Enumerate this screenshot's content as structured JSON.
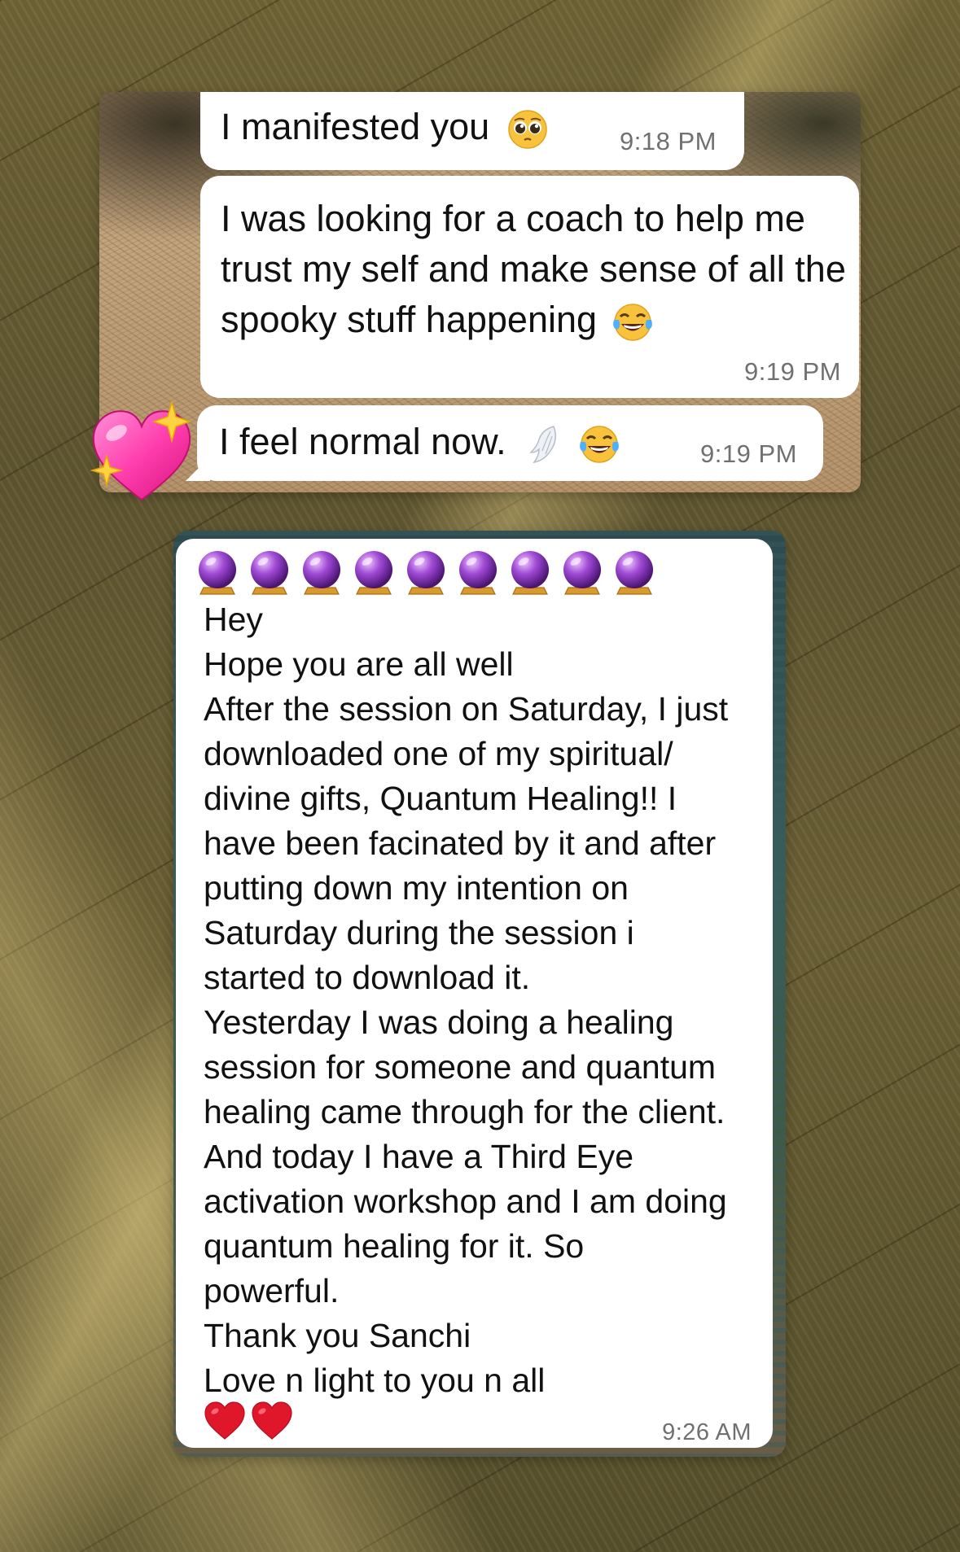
{
  "top_chat": {
    "messages": [
      {
        "text": "I manifested you",
        "emoji": "pleading-face-icon",
        "time": "9:18 PM"
      },
      {
        "text": "I was looking for a coach to help me trust my self and make sense of all the spooky stuff  happening",
        "emoji": "tears-of-joy-icon",
        "time": "9:19 PM"
      },
      {
        "text": "I feel normal now.",
        "emoji": "wing-and-tears-of-joy-icons",
        "time": "9:19 PM"
      }
    ],
    "reaction_sticker": "sparkling-heart-icon"
  },
  "bottom_chat": {
    "sender_decoration": "crystal-ball-icon",
    "sender_decoration_count": 9,
    "lines": [
      "Hey",
      "Hope you are all well",
      "After the session on Saturday, I just",
      "downloaded one of my spiritual/",
      "divine gifts, Quantum Healing!! I",
      "have been facinated by it and after",
      "putting down my intention on",
      "Saturday during the session i",
      "started to download it.",
      "Yesterday I was doing a healing",
      "session for someone and quantum",
      "healing came through for the client.",
      "And today I have a Third Eye",
      "activation workshop and I am doing",
      "quantum healing for it. So",
      "powerful.",
      "Thank you Sanchi",
      "Love n light to you n all"
    ],
    "closing_emoji": "red-heart-icon",
    "time": "9:26 AM"
  },
  "colors": {
    "bubble": "#ffffff",
    "text": "#111111",
    "timestamp": "#707070",
    "heart": "#e0162b",
    "sticker_heart": "#ff4fb5"
  }
}
